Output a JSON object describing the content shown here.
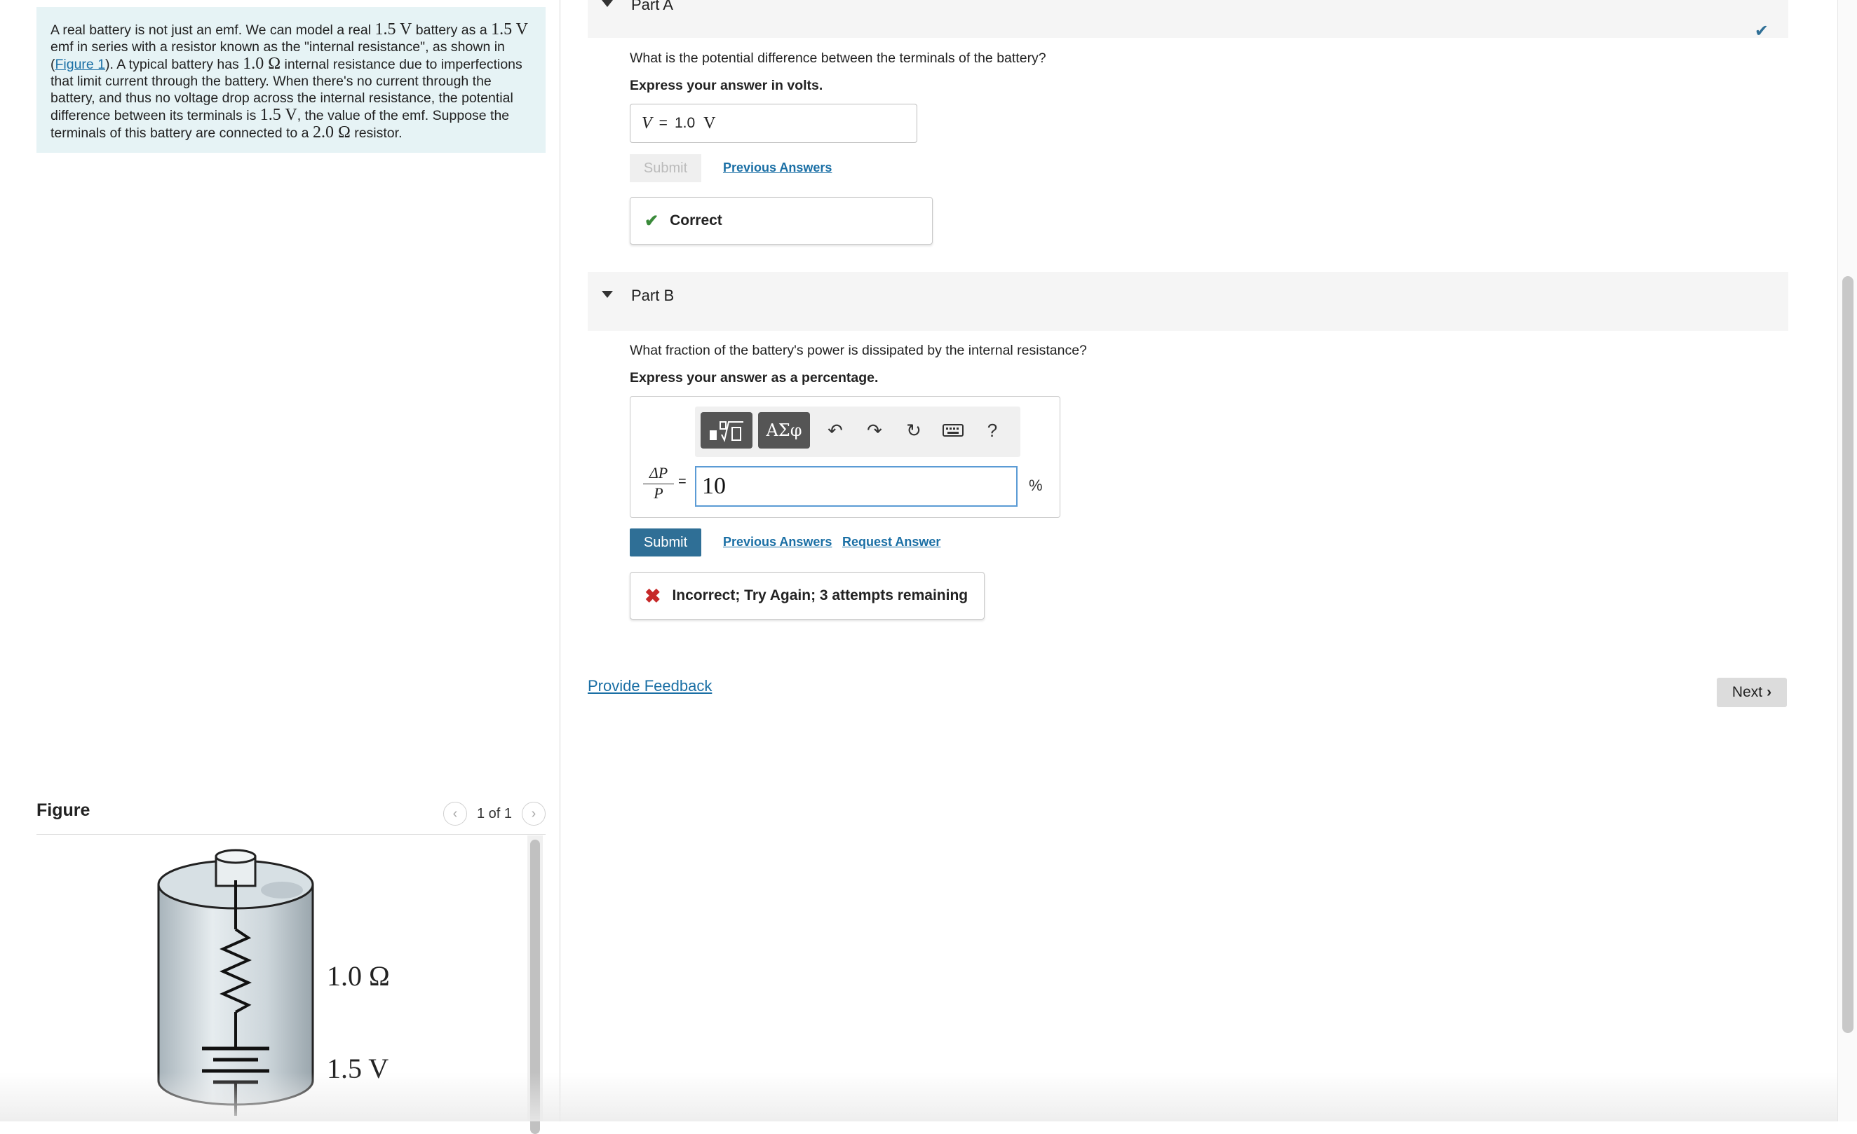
{
  "intro": {
    "s1": "A real battery is not just an emf. We can model a real ",
    "m1": "1.5 V",
    "s2": " battery as a ",
    "m2": "1.5 V",
    "s3": " emf in series with a resistor known as the \"internal resistance\", as shown in (",
    "fig_link": "Figure 1",
    "s4": "). A typical battery has ",
    "m3": "1.0 Ω",
    "s5": " internal resistance due to imperfections that limit current through the battery. When there's no current through the battery, and thus no voltage drop across the internal resistance, the potential difference between its terminals is ",
    "m4": "1.5 V",
    "s6": ", the value of the emf.  Suppose the terminals of this battery are connected to a ",
    "m5": "2.0 Ω",
    "s7": " resistor."
  },
  "figure": {
    "title": "Figure",
    "pager": "1 of 1",
    "resistance_label": "1.0 Ω",
    "emf_label": "1.5 V"
  },
  "part_a": {
    "title": "Part A",
    "question": "What is the potential difference between the terminals of the battery?",
    "instruction": "Express your answer in volts.",
    "answer_var": "V",
    "answer_eq": "=",
    "answer_value": "1.0",
    "answer_unit": "V",
    "submit_label": "Submit",
    "previous_answers": "Previous Answers",
    "feedback": "Correct",
    "feedback_color": "#3a8a3a"
  },
  "part_b": {
    "title": "Part B",
    "question": "What fraction of the battery's power is dissipated by the internal resistance?",
    "instruction": "Express your answer as a percentage.",
    "lhs_num": "ΔP",
    "lhs_den": "P",
    "eq": "=",
    "answer_value": "10",
    "unit": "%",
    "toolbar": {
      "templates_icon": "templates-icon",
      "greek_label": "ΑΣφ",
      "undo_icon": "undo-icon",
      "redo_icon": "redo-icon",
      "reset_icon": "reset-icon",
      "keyboard_icon": "keyboard-icon",
      "help_label": "?"
    },
    "submit_label": "Submit",
    "previous_answers": "Previous Answers",
    "request_answer": "Request Answer",
    "feedback": "Incorrect; Try Again; 3 attempts remaining",
    "feedback_color": "#c62828"
  },
  "footer": {
    "provide_feedback": "Provide Feedback",
    "next_label": "Next"
  },
  "colors": {
    "accent": "#2f6f96",
    "link": "#1a6fa5",
    "intro_bg": "#e6f3f5"
  }
}
